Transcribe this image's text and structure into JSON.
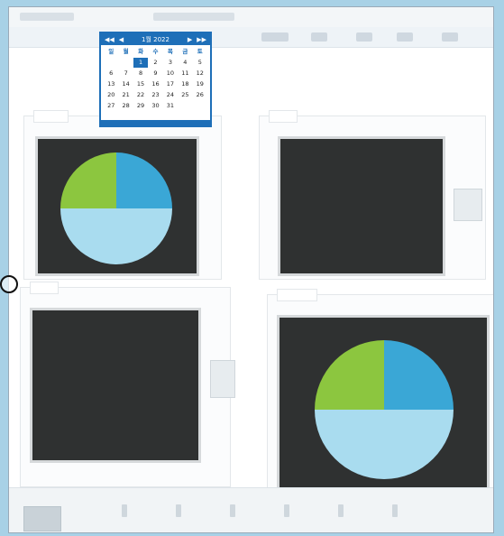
{
  "calendar": {
    "nav_prev_year": "◀◀",
    "nav_prev_month": "◀",
    "nav_next_month": "▶",
    "nav_next_year": "▶▶",
    "title": "1월 2022",
    "weekdays": [
      "일",
      "월",
      "화",
      "수",
      "목",
      "금",
      "토"
    ],
    "days": [
      [
        "",
        "",
        "",
        "1",
        "2",
        "3",
        "4",
        "5"
      ],
      [
        "6",
        "7",
        "8",
        "9",
        "10",
        "11",
        "12"
      ],
      [
        "13",
        "14",
        "15",
        "16",
        "17",
        "18",
        "19"
      ],
      [
        "20",
        "21",
        "22",
        "23",
        "24",
        "25",
        "26"
      ],
      [
        "27",
        "28",
        "29",
        "30",
        "31",
        "",
        ""
      ]
    ],
    "selected_day": "1"
  },
  "colors": {
    "calendar_accent": "#1e6fb8",
    "screen_bg": "#2f3131",
    "pie_light_blue": "#a9dcef",
    "pie_green": "#8cc63f",
    "pie_blue": "#3aa7d6"
  },
  "chart_data": [
    {
      "type": "pie",
      "values": [
        50,
        25,
        25
      ],
      "colors": [
        "#a9dcef",
        "#8cc63f",
        "#3aa7d6"
      ]
    },
    {
      "type": "pie",
      "values": [
        50,
        25,
        25
      ],
      "colors": [
        "#a9dcef",
        "#8cc63f",
        "#3aa7d6"
      ]
    }
  ]
}
